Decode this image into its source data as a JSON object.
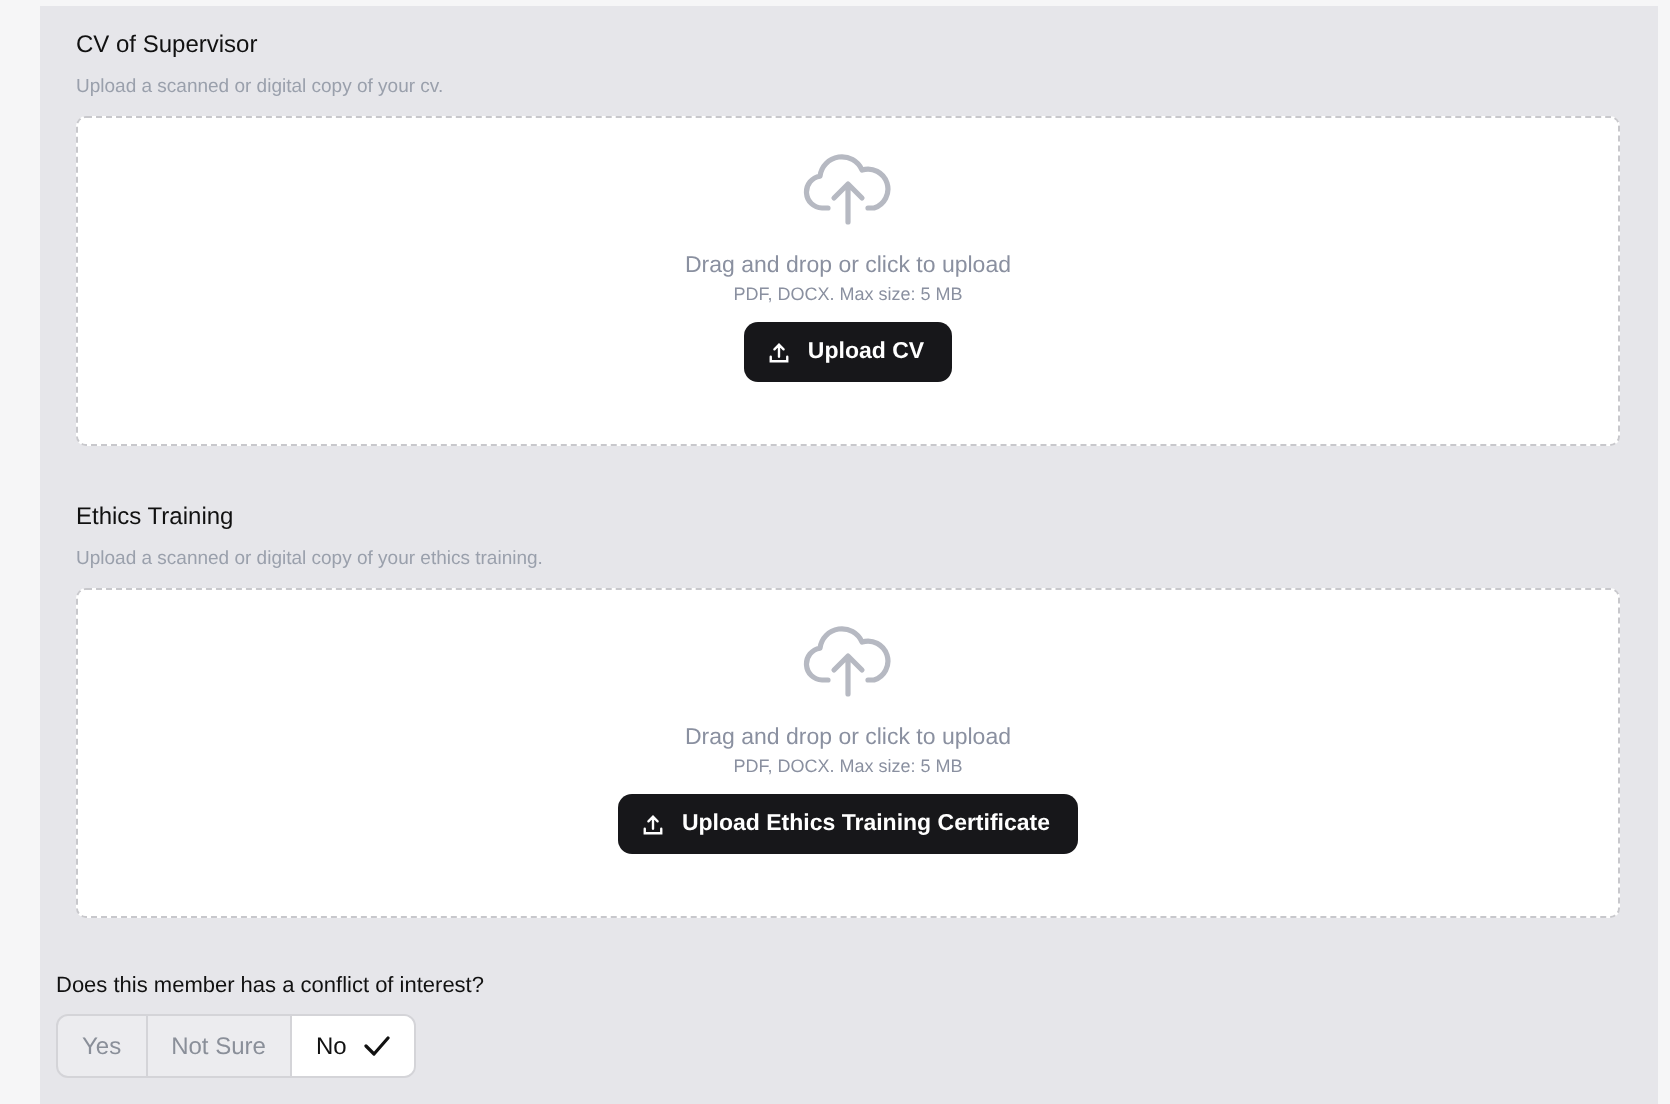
{
  "uploads": [
    {
      "title": "CV of Supervisor",
      "description": "Upload a scanned or digital copy of your cv.",
      "prompt": "Drag and drop or click to upload",
      "hint": "PDF, DOCX. Max size: 5 MB",
      "button": "Upload CV"
    },
    {
      "title": "Ethics Training",
      "description": "Upload a scanned or digital copy of your ethics training.",
      "prompt": "Drag and drop or click to upload",
      "hint": "PDF, DOCX. Max size: 5 MB",
      "button": "Upload Ethics Training Certificate"
    }
  ],
  "question": {
    "label": "Does this member has a conflict of interest?",
    "options": [
      {
        "label": "Yes",
        "selected": false
      },
      {
        "label": "Not Sure",
        "selected": false
      },
      {
        "label": "No",
        "selected": true
      }
    ]
  }
}
